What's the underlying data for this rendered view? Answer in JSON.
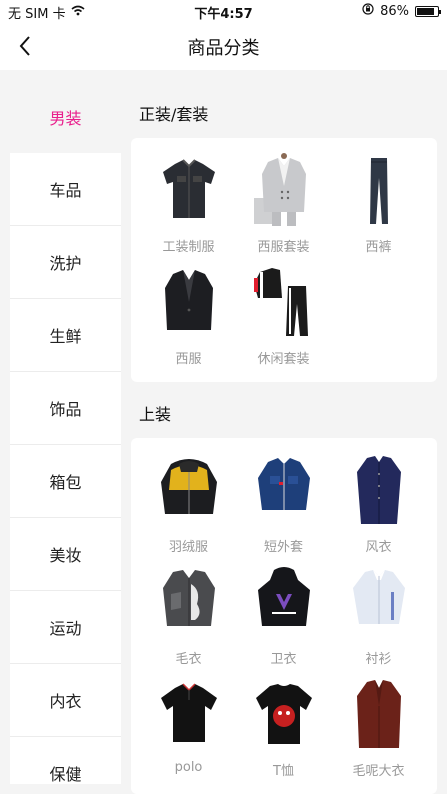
{
  "status": {
    "carrier": "无 SIM 卡",
    "time": "下午4:57",
    "battery": "86%",
    "battery_level": 0.86
  },
  "nav": {
    "title": "商品分类"
  },
  "sidebar": {
    "items": [
      {
        "label": "男装"
      },
      {
        "label": "车品"
      },
      {
        "label": "洗护"
      },
      {
        "label": "生鲜"
      },
      {
        "label": "饰品"
      },
      {
        "label": "箱包"
      },
      {
        "label": "美妆"
      },
      {
        "label": "运动"
      },
      {
        "label": "内衣"
      },
      {
        "label": "保健"
      }
    ]
  },
  "sections": [
    {
      "title": "正装/套装",
      "items": [
        {
          "label": "工装制服"
        },
        {
          "label": "西服套装"
        },
        {
          "label": "西裤"
        },
        {
          "label": "西服"
        },
        {
          "label": "休闲套装"
        }
      ]
    },
    {
      "title": "上装",
      "items": [
        {
          "label": "羽绒服"
        },
        {
          "label": "短外套"
        },
        {
          "label": "风衣"
        },
        {
          "label": "毛衣"
        },
        {
          "label": "卫衣"
        },
        {
          "label": "衬衫"
        },
        {
          "label": "polo"
        },
        {
          "label": "T恤"
        },
        {
          "label": "毛呢大衣"
        }
      ]
    }
  ],
  "colors": {
    "accent": "#e91e8c"
  }
}
